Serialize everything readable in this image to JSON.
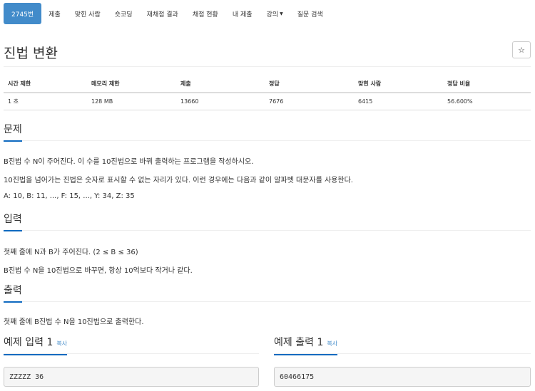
{
  "nav": {
    "tabs": [
      {
        "label": "2745번",
        "active": true
      },
      {
        "label": "제출"
      },
      {
        "label": "맞힌 사람"
      },
      {
        "label": "숏코딩"
      },
      {
        "label": "재채점 결과"
      },
      {
        "label": "채점 현황"
      },
      {
        "label": "내 제출"
      },
      {
        "label": "강의"
      },
      {
        "label": "질문 검색"
      }
    ]
  },
  "problem": {
    "title": "진법 변환",
    "star_icon": "☆"
  },
  "info": {
    "headers": [
      "시간 제한",
      "메모리 제한",
      "제출",
      "정답",
      "맞힌 사람",
      "정답 비율"
    ],
    "values": [
      "1 초",
      "128 MB",
      "13660",
      "7676",
      "6415",
      "56.600%"
    ]
  },
  "sections": {
    "problem": {
      "title": "문제",
      "lines": [
        "B진법 수 N이 주어진다. 이 수를 10진법으로 바꿔 출력하는 프로그램을 작성하시오.",
        "10진법을 넘어가는 진법은 숫자로 표시할 수 없는 자리가 있다. 이런 경우에는 다음과 같이 알파벳 대문자를 사용한다.",
        "A: 10, B: 11, ..., F: 15, ..., Y: 34, Z: 35"
      ]
    },
    "input": {
      "title": "입력",
      "lines": [
        "첫째 줄에 N과 B가 주어진다. (2 ≤ B ≤ 36)",
        "B진법 수 N을 10진법으로 바꾸면, 항상 10억보다 작거나 같다."
      ]
    },
    "output": {
      "title": "출력",
      "lines": [
        "첫째 줄에 B진법 수 N을 10진법으로 출력한다."
      ]
    }
  },
  "samples": {
    "input": {
      "title": "예제 입력",
      "num": "1",
      "copy": "복사",
      "content": "ZZZZZ 36"
    },
    "output": {
      "title": "예제 출력",
      "num": "1",
      "copy": "복사",
      "content": "60466175"
    }
  }
}
